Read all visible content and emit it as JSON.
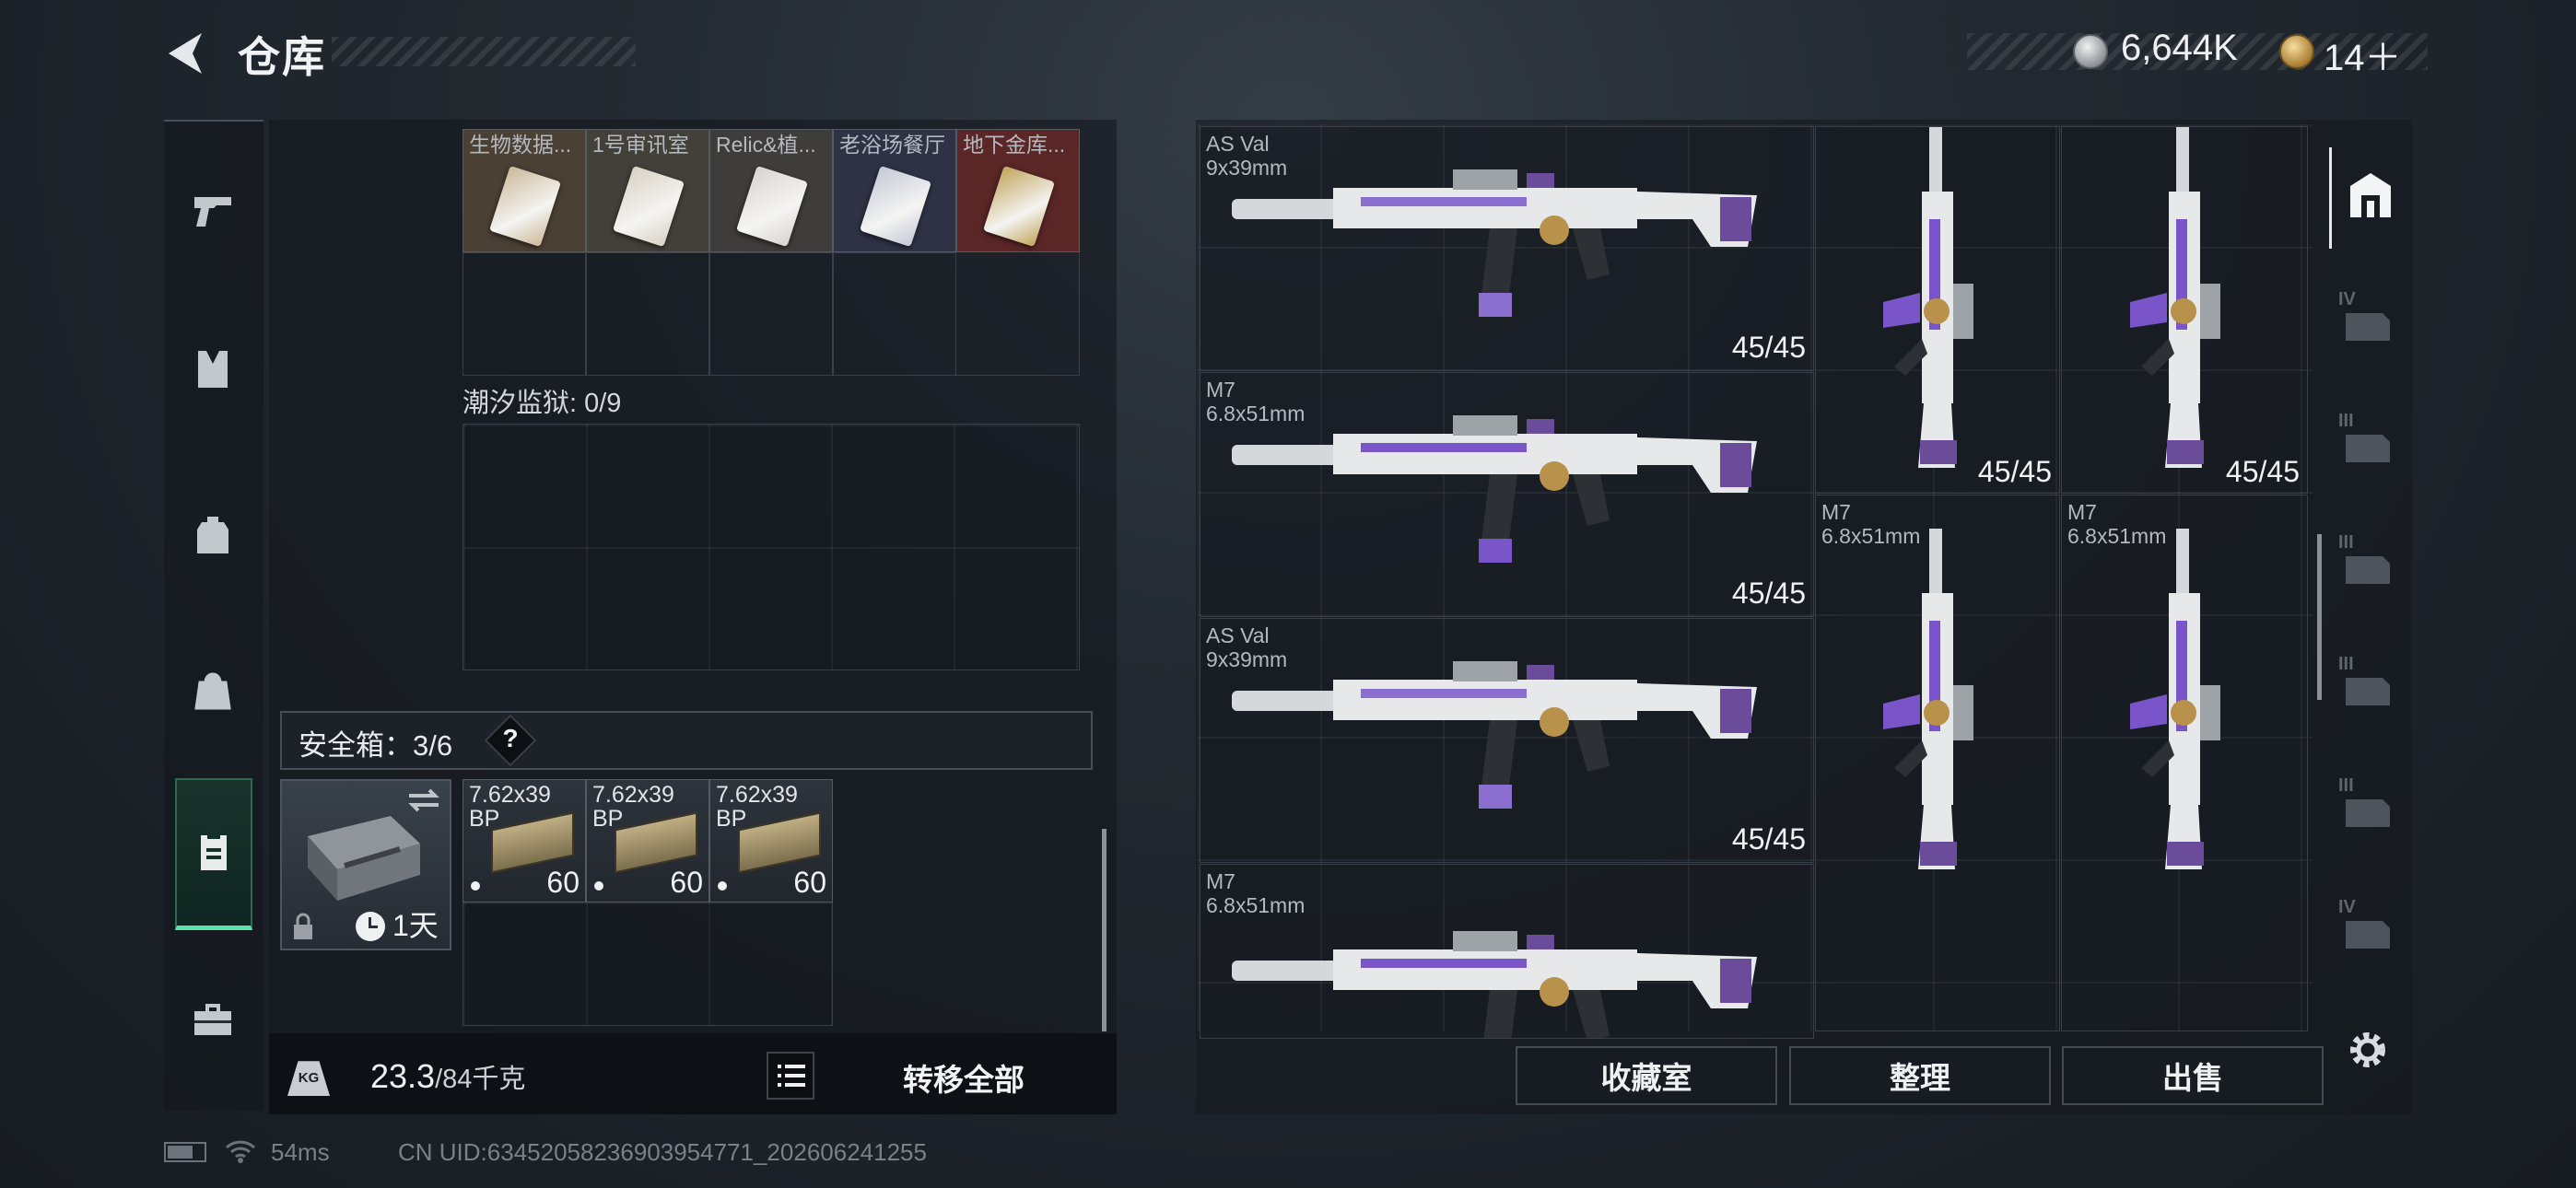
{
  "header": {
    "title": "仓库",
    "currency1": "6,644K",
    "currency2": "14＋"
  },
  "sidebar": {
    "items": [
      {
        "icon": "pistol-icon"
      },
      {
        "icon": "vest-icon"
      },
      {
        "icon": "backpack-icon"
      },
      {
        "icon": "bag-icon"
      },
      {
        "icon": "clipboard-icon",
        "active": true
      },
      {
        "icon": "toolbox-icon"
      }
    ]
  },
  "left": {
    "key_items": [
      "生物数据...",
      "1号审讯室",
      "Relic&植...",
      "老浴场餐厅",
      "地下金库..."
    ],
    "prison_label": "潮汐监狱: 0/9",
    "safebox_label": "安全箱：3/6",
    "safebox_help": "?",
    "safebox_time": "1天",
    "ammo": [
      {
        "name": "7.62x39",
        "sub": "BP",
        "count": "60"
      },
      {
        "name": "7.62x39",
        "sub": "BP",
        "count": "60"
      },
      {
        "name": "7.62x39",
        "sub": "BP",
        "count": "60"
      }
    ],
    "weight_value": "23.3",
    "weight_max": "/84千克",
    "weight_icon_label": "KG",
    "transfer_all": "转移全部"
  },
  "right": {
    "weapons": [
      {
        "name": "AS Val",
        "caliber": "9x39mm",
        "ammo": "45/45"
      },
      {
        "name": "M7",
        "caliber": "6.8x51mm",
        "ammo": "45/45"
      },
      {
        "name": "AS Val",
        "caliber": "9x39mm",
        "ammo": "45/45"
      },
      {
        "name": "M7",
        "caliber": "6.8x51mm",
        "ammo": ""
      }
    ],
    "vertical": [
      {
        "name": "",
        "caliber": "",
        "ammo": "45/45"
      },
      {
        "name": "",
        "caliber": "",
        "ammo": "45/45"
      },
      {
        "name": "M7",
        "caliber": "6.8x51mm",
        "ammo": ""
      },
      {
        "name": "M7",
        "caliber": "6.8x51mm",
        "ammo": ""
      }
    ],
    "buttons": [
      "收藏室",
      "整理",
      "出售"
    ],
    "tabs": [
      "IV",
      "III",
      "III",
      "III",
      "III",
      "IV"
    ]
  },
  "status": {
    "ping": "54ms",
    "uid": "CN UID:6345205823690395477​1_202606241255"
  }
}
